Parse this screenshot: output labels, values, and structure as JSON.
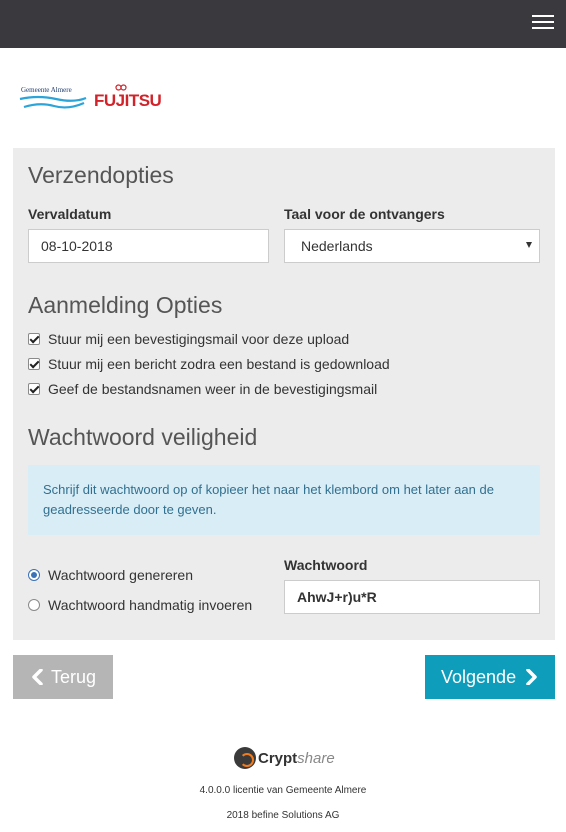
{
  "header": {
    "menu_icon": "hamburger-menu-icon"
  },
  "logos": {
    "almere_text": "Gemeente Almere",
    "fujitsu_text": "FUJITSU",
    "colors": {
      "almere": "#1d3c6e",
      "almere_wave": "#2ba4d9",
      "fujitsu": "#d2232a"
    }
  },
  "verzendopties": {
    "title": "Verzendopties",
    "vervaldatum_label": "Vervaldatum",
    "vervaldatum_value": "08-10-2018",
    "taal_label": "Taal voor de ontvangers",
    "taal_value": "Nederlands"
  },
  "aanmelding": {
    "title": "Aanmelding Opties",
    "options": [
      {
        "label": "Stuur mij een bevestigingsmail voor deze upload",
        "checked": true
      },
      {
        "label": "Stuur mij een bericht zodra een bestand is gedownload",
        "checked": true
      },
      {
        "label": "Geef de bestandsnamen weer in de bevestigingsmail",
        "checked": true
      }
    ]
  },
  "wachtwoord": {
    "title": "Wachtwoord veiligheid",
    "info_text": "Schrijf dit wachtwoord op of kopieer het naar het klembord om het later aan de geadresseerde door te geven.",
    "radios": [
      {
        "label": "Wachtwoord genereren",
        "selected": true
      },
      {
        "label": "Wachtwoord handmatig invoeren",
        "selected": false
      }
    ],
    "password_label": "Wachtwoord",
    "password_value": "AhwJ+r)u*R"
  },
  "nav": {
    "back_label": "Terug",
    "next_label": "Volgende",
    "colors": {
      "back": "#b5b5b5",
      "next": "#0e9ebb"
    }
  },
  "footer": {
    "brand_crypt": "Crypt",
    "brand_share": "share",
    "license": "4.0.0.0 licentie van Gemeente Almere",
    "copyright": "2018 befine Solutions AG"
  }
}
